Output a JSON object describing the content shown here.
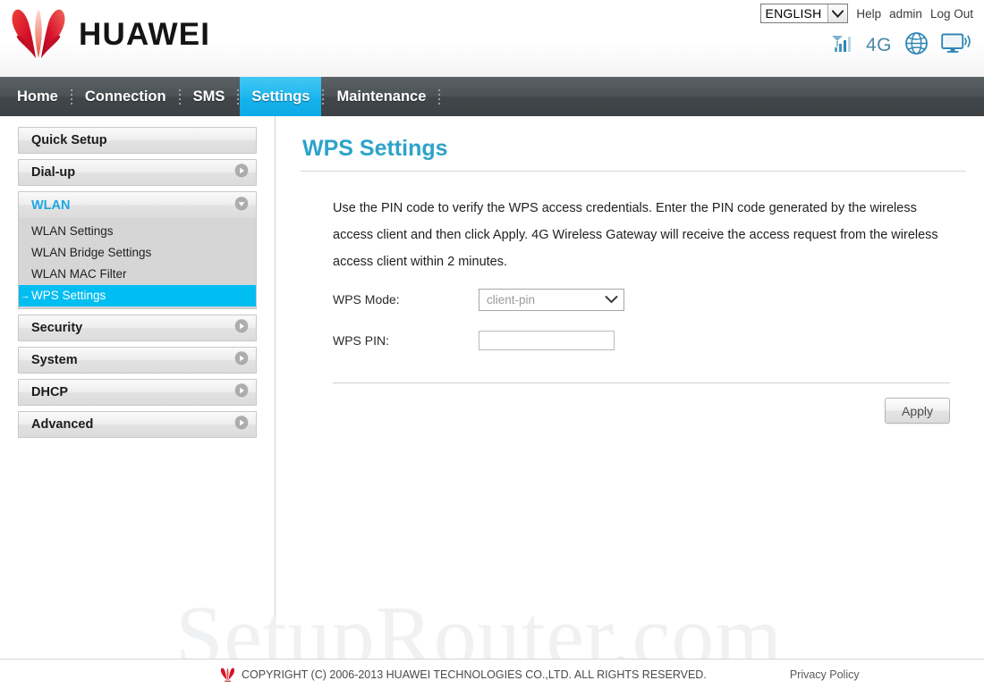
{
  "header": {
    "brand": "HUAWEI",
    "brand_icon": "huawei-flower-logo",
    "language": {
      "selected": "ENGLISH",
      "icon": "chevron-down-icon"
    },
    "links": [
      {
        "label": "Help",
        "name": "help-link"
      },
      {
        "label": "admin",
        "name": "admin-link"
      },
      {
        "label": "Log Out",
        "name": "logout-link"
      }
    ],
    "status_icons": [
      {
        "name": "signal-strength-icon",
        "label": "signal-bars"
      },
      {
        "name": "network-type-label",
        "label": "4G"
      },
      {
        "name": "globe-icon",
        "label": "internet"
      },
      {
        "name": "wlan-monitor-icon",
        "label": "wireless-display"
      }
    ],
    "accent_color": "#00bdf2",
    "brand_red": "#d6132b"
  },
  "nav": {
    "items": [
      {
        "label": "Home",
        "active": false
      },
      {
        "label": "Connection",
        "active": false
      },
      {
        "label": "SMS",
        "active": false
      },
      {
        "label": "Settings",
        "active": true
      },
      {
        "label": "Maintenance",
        "active": false
      }
    ]
  },
  "sidebar": {
    "blocks": [
      {
        "label": "Quick Setup",
        "state": "plain",
        "icon": ""
      },
      {
        "label": "Dial-up",
        "state": "collapsed",
        "icon": "chevron-right-circle-icon"
      },
      {
        "label": "WLAN",
        "state": "expanded",
        "icon": "chevron-down-circle-icon",
        "items": [
          {
            "label": "WLAN Settings",
            "active": false
          },
          {
            "label": "WLAN Bridge Settings",
            "active": false
          },
          {
            "label": "WLAN MAC Filter",
            "active": false
          },
          {
            "label": "WPS Settings",
            "active": true,
            "arrow": "→"
          }
        ]
      },
      {
        "label": "Security",
        "state": "collapsed",
        "icon": "chevron-right-circle-icon"
      },
      {
        "label": "System",
        "state": "collapsed",
        "icon": "chevron-right-circle-icon"
      },
      {
        "label": "DHCP",
        "state": "collapsed",
        "icon": "chevron-right-circle-icon"
      },
      {
        "label": "Advanced",
        "state": "collapsed",
        "icon": "chevron-right-circle-icon"
      }
    ]
  },
  "main": {
    "title": "WPS Settings",
    "description": "Use the PIN code to verify the WPS access credentials. Enter the PIN code generated by the wireless access client and then click Apply. 4G Wireless Gateway will receive the access request from the wireless access client within 2 minutes.",
    "fields": {
      "wps_mode": {
        "label": "WPS Mode:",
        "value": "client-pin",
        "icon": "chevron-down-icon"
      },
      "wps_pin": {
        "label": "WPS PIN:",
        "value": "",
        "placeholder": ""
      }
    },
    "apply_label": "Apply"
  },
  "watermark": "SetupRouter.com",
  "footer": {
    "logo_icon": "huawei-flower-logo-small",
    "copyright": "COPYRIGHT (C) 2006-2013 HUAWEI TECHNOLOGIES CO.,LTD. ALL RIGHTS RESERVED.",
    "privacy_label": "Privacy Policy"
  }
}
